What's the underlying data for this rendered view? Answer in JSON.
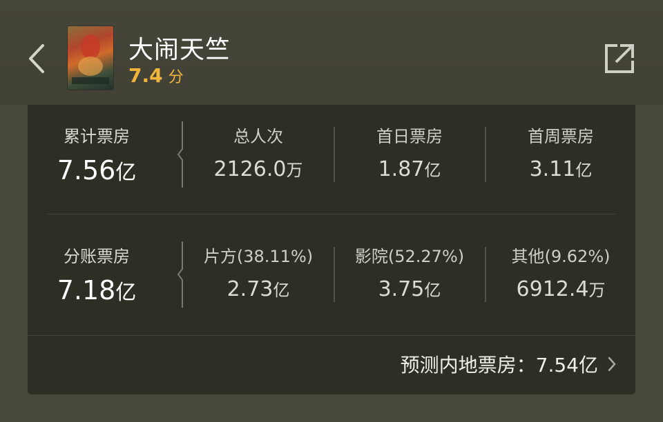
{
  "movie": {
    "title": "大闹天竺",
    "score": "7.4",
    "score_unit": "分"
  },
  "cumulative": {
    "label": "累计票房",
    "value": "7.56",
    "unit": "亿"
  },
  "totals": [
    {
      "label": "总人次",
      "value": "2126.0",
      "unit": "万"
    },
    {
      "label": "首日票房",
      "value": "1.87",
      "unit": "亿"
    },
    {
      "label": "首周票房",
      "value": "3.11",
      "unit": "亿"
    }
  ],
  "split": {
    "label": "分账票房",
    "value": "7.18",
    "unit": "亿"
  },
  "split_parts": [
    {
      "label": "片方(38.11%)",
      "value": "2.73",
      "unit": "亿"
    },
    {
      "label": "影院(52.27%)",
      "value": "3.75",
      "unit": "亿"
    },
    {
      "label": "其他(9.62%)",
      "value": "6912.4",
      "unit": "万"
    }
  ],
  "forecast": {
    "text": "预测内地票房：7.54亿"
  },
  "colors": {
    "accent": "#f2b53b",
    "card_bg": "#2f2e24",
    "header_bg": "#46453a"
  },
  "icons": {
    "back": "chevron-left-icon",
    "share": "share-external-icon",
    "forecast": "chevron-right-icon"
  }
}
